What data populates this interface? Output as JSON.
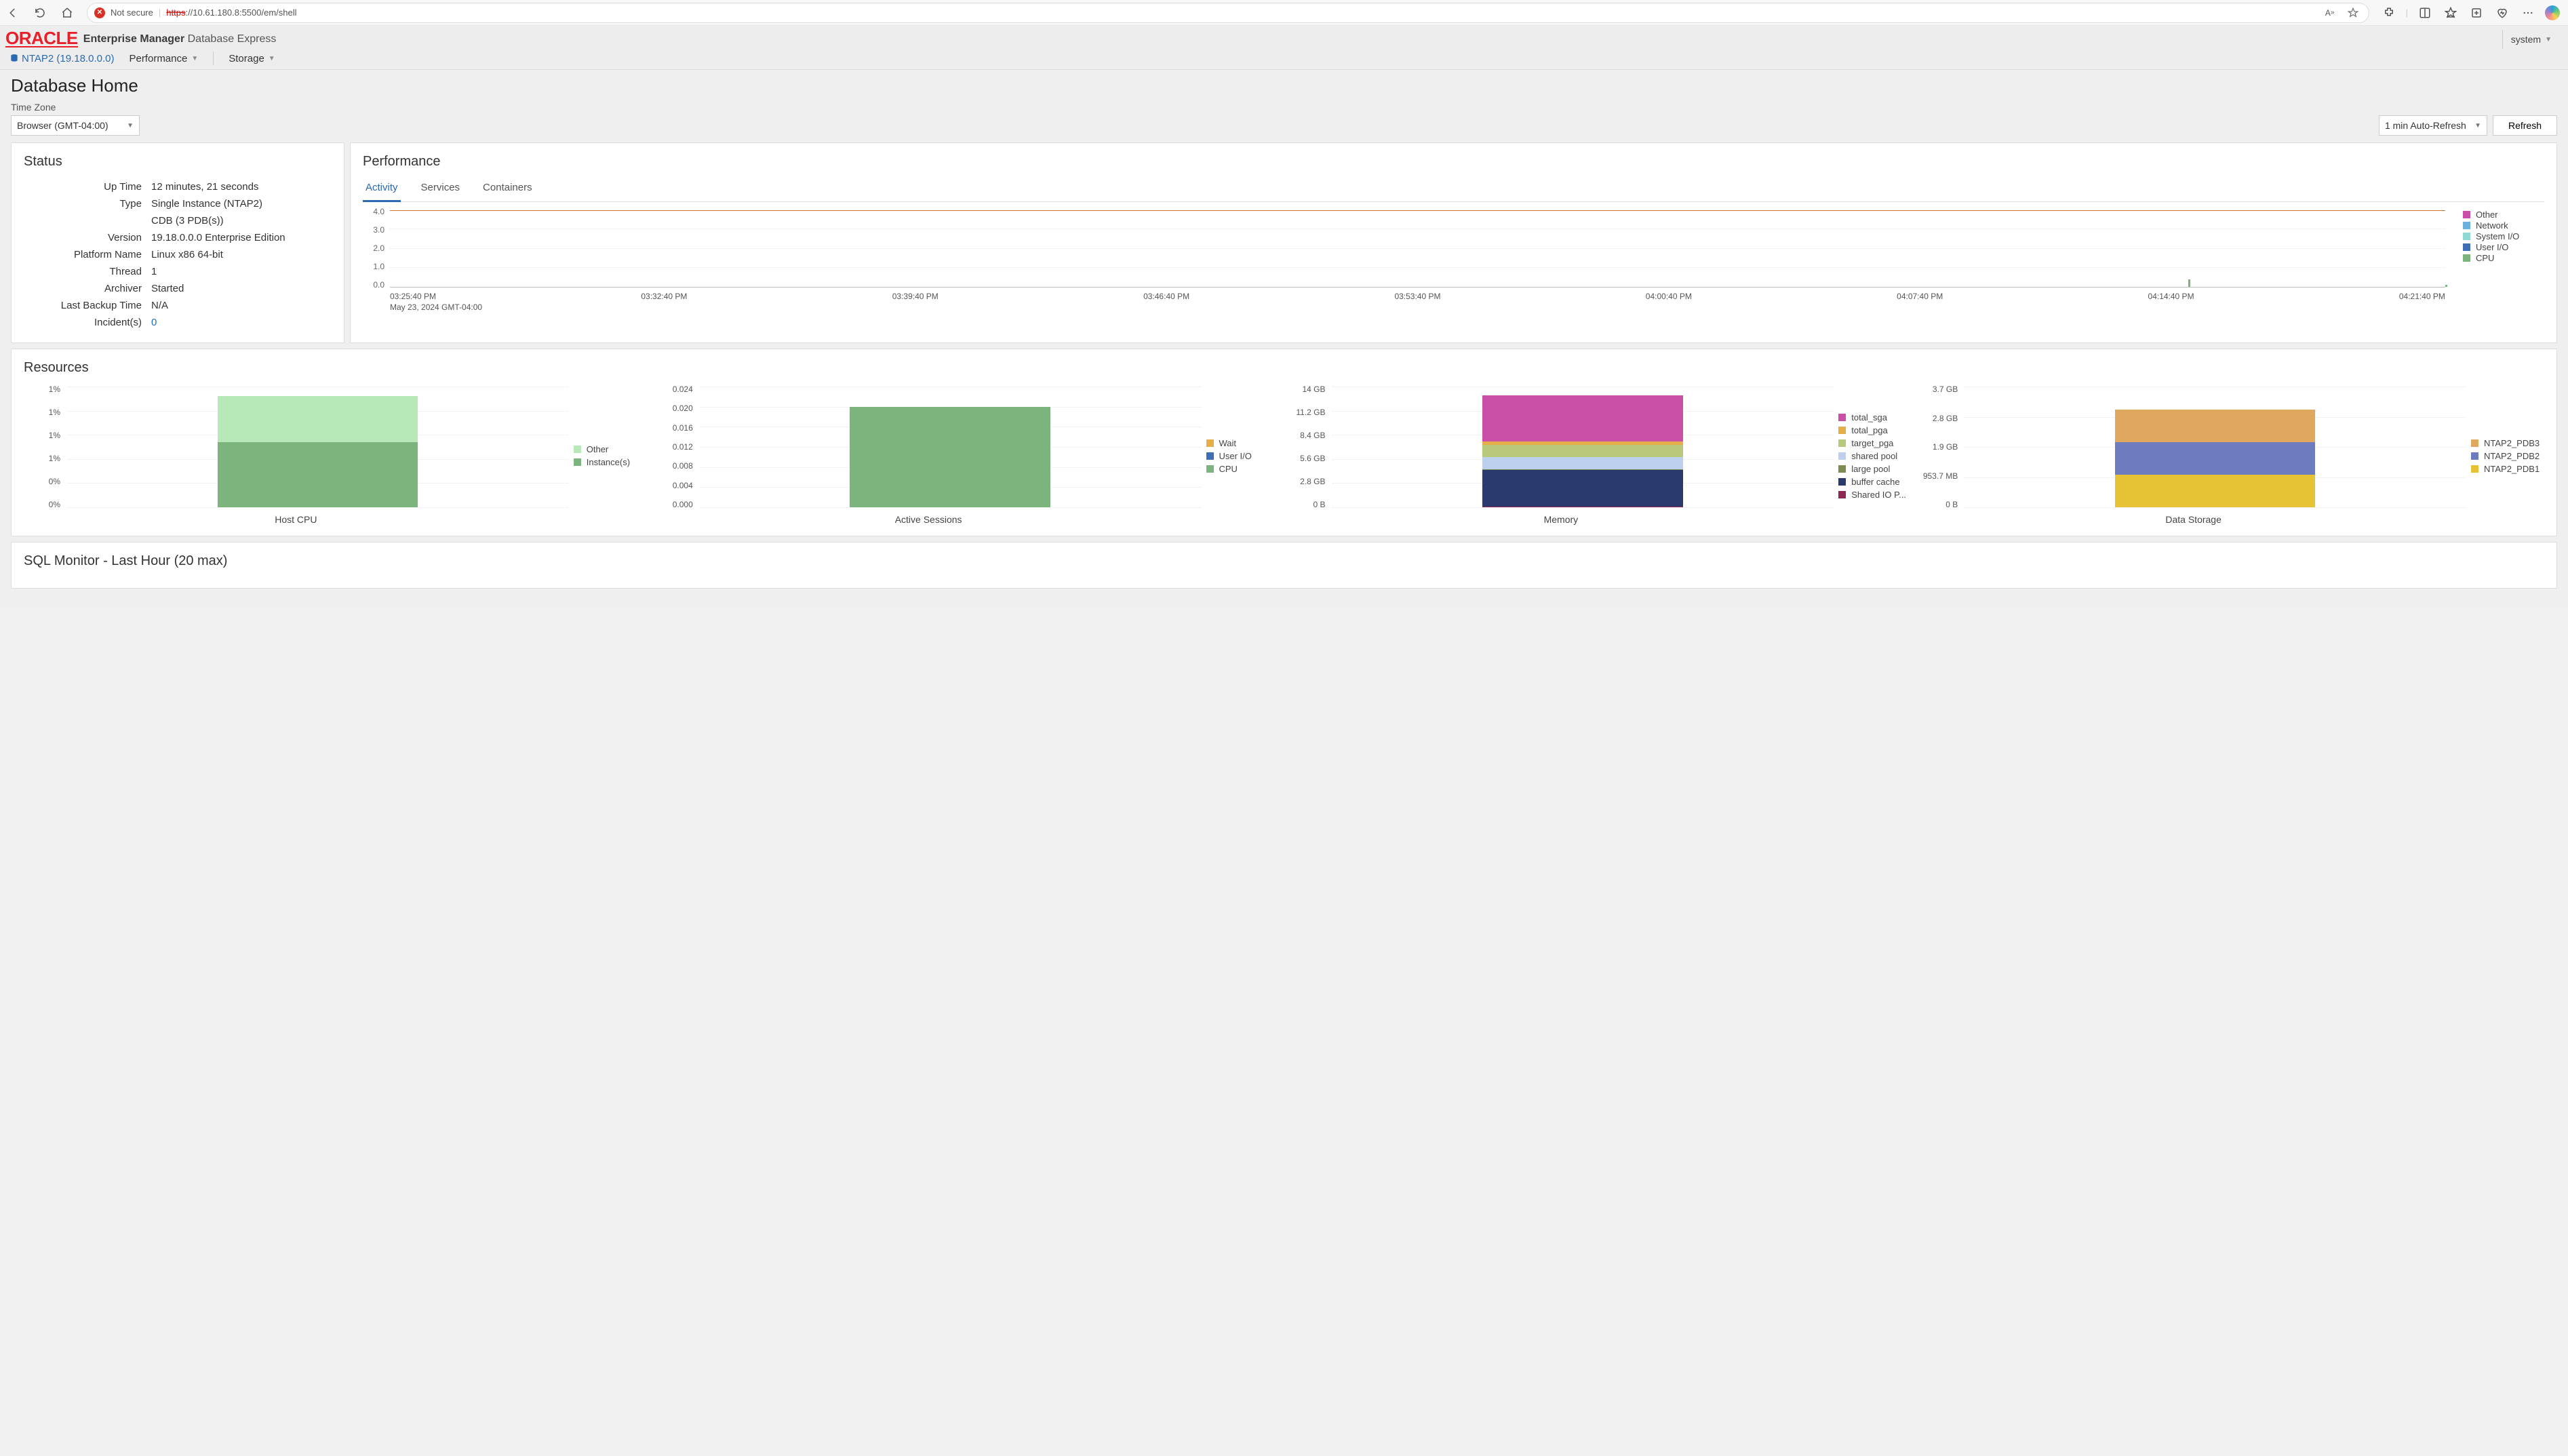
{
  "browser": {
    "not_secure_label": "Not secure",
    "url_proto": "https",
    "url_rest": "://10.61.180.8:5500/em/shell"
  },
  "header": {
    "logo_text": "ORACLE",
    "product_bold": "Enterprise Manager",
    "product_light": "Database Express",
    "user": "system"
  },
  "nav": {
    "target": "NTAP2 (19.18.0.0.0)",
    "menu1": "Performance",
    "menu2": "Storage"
  },
  "page_title": "Database Home",
  "tz_label": "Time Zone",
  "tz_value": "Browser (GMT-04:00)",
  "refresh_select": "1 min Auto-Refresh",
  "refresh_btn": "Refresh",
  "status": {
    "title": "Status",
    "rows": [
      {
        "label": "Up Time",
        "value": "12 minutes, 21 seconds"
      },
      {
        "label": "Type",
        "value": "Single Instance (NTAP2)"
      },
      {
        "label": "",
        "value": "CDB (3 PDB(s))"
      },
      {
        "label": "Version",
        "value": "19.18.0.0.0 Enterprise Edition"
      },
      {
        "label": "Platform Name",
        "value": "Linux x86 64-bit"
      },
      {
        "label": "Thread",
        "value": "1"
      },
      {
        "label": "Archiver",
        "value": "Started"
      },
      {
        "label": "Last Backup Time",
        "value": "N/A"
      },
      {
        "label": "Incident(s)",
        "value": "0",
        "link": true
      }
    ]
  },
  "performance": {
    "title": "Performance",
    "tabs": [
      "Activity",
      "Services",
      "Containers"
    ],
    "active_tab": 0,
    "y_ticks": [
      "4.0",
      "3.0",
      "2.0",
      "1.0",
      "0.0"
    ],
    "x_ticks": [
      "03:25:40 PM",
      "03:32:40 PM",
      "03:39:40 PM",
      "03:46:40 PM",
      "03:53:40 PM",
      "04:00:40 PM",
      "04:07:40 PM",
      "04:14:40 PM",
      "04:21:40 PM"
    ],
    "date_line": "May 23, 2024 GMT-04:00",
    "legend": [
      {
        "label": "Other",
        "color": "#c94fa9"
      },
      {
        "label": "Network",
        "color": "#6cb0e0"
      },
      {
        "label": "System I/O",
        "color": "#8fd8d4"
      },
      {
        "label": "User I/O",
        "color": "#3e6fb6"
      },
      {
        "label": "CPU",
        "color": "#7cb47e"
      }
    ]
  },
  "resources": {
    "title": "Resources",
    "host_cpu": {
      "title": "Host CPU",
      "y_ticks": [
        "1%",
        "1%",
        "1%",
        "1%",
        "0%",
        "0%"
      ],
      "legend": [
        {
          "label": "Other",
          "color": "#b9e8b8"
        },
        {
          "label": "Instance(s)",
          "color": "#7cb47e"
        }
      ]
    },
    "active_sessions": {
      "title": "Active Sessions",
      "y_ticks": [
        "0.024",
        "0.020",
        "0.016",
        "0.012",
        "0.008",
        "0.004",
        "0.000"
      ],
      "legend": [
        {
          "label": "Wait",
          "color": "#e6ae49"
        },
        {
          "label": "User I/O",
          "color": "#3e6fb6"
        },
        {
          "label": "CPU",
          "color": "#7cb47e"
        }
      ]
    },
    "memory": {
      "title": "Memory",
      "y_ticks": [
        "14 GB",
        "11.2 GB",
        "8.4 GB",
        "5.6 GB",
        "2.8 GB",
        "0 B"
      ],
      "legend": [
        {
          "label": "total_sga",
          "color": "#c94fa9"
        },
        {
          "label": "total_pga",
          "color": "#e6ae49"
        },
        {
          "label": "target_pga",
          "color": "#b9c97c"
        },
        {
          "label": "shared pool",
          "color": "#bcd0ee"
        },
        {
          "label": "large pool",
          "color": "#7c8e4f"
        },
        {
          "label": "buffer cache",
          "color": "#2b3a6e"
        },
        {
          "label": "Shared IO P...",
          "color": "#8b2752"
        }
      ]
    },
    "data_storage": {
      "title": "Data Storage",
      "y_ticks": [
        "3.7 GB",
        "2.8 GB",
        "1.9 GB",
        "953.7 MB",
        "0 B"
      ],
      "legend": [
        {
          "label": "NTAP2_PDB3",
          "color": "#e0a85e"
        },
        {
          "label": "NTAP2_PDB2",
          "color": "#6d7bbf"
        },
        {
          "label": "NTAP2_PDB1",
          "color": "#e6c235"
        }
      ]
    }
  },
  "sql_monitor": {
    "title": "SQL Monitor - Last Hour (20 max)"
  },
  "chart_data": {
    "activity": {
      "type": "area",
      "title": "Activity",
      "xlabel": "",
      "ylabel": "",
      "ylim": [
        0,
        4.0
      ],
      "x": [
        "03:25:40 PM",
        "03:32:40 PM",
        "03:39:40 PM",
        "03:46:40 PM",
        "03:53:40 PM",
        "04:00:40 PM",
        "04:07:40 PM",
        "04:14:40 PM",
        "04:21:40 PM"
      ],
      "baseline": 4.0,
      "series": [
        {
          "name": "Other",
          "color": "#c94fa9",
          "values": [
            0,
            0,
            0,
            0,
            0,
            0,
            0,
            0.3,
            0
          ]
        },
        {
          "name": "Network",
          "color": "#6cb0e0",
          "values": [
            0,
            0,
            0,
            0,
            0,
            0,
            0,
            0,
            0
          ]
        },
        {
          "name": "System I/O",
          "color": "#8fd8d4",
          "values": [
            0,
            0,
            0,
            0,
            0,
            0,
            0,
            0,
            0
          ]
        },
        {
          "name": "User I/O",
          "color": "#3e6fb6",
          "values": [
            0,
            0,
            0,
            0,
            0,
            0,
            0,
            0,
            0
          ]
        },
        {
          "name": "CPU",
          "color": "#7cb47e",
          "values": [
            0,
            0,
            0,
            0,
            0,
            0,
            0,
            0.4,
            0.1
          ]
        }
      ],
      "date": "May 23, 2024 GMT-04:00"
    },
    "host_cpu": {
      "type": "bar",
      "title": "Host CPU",
      "categories": [
        ""
      ],
      "ylim": [
        0,
        1.3
      ],
      "unit": "%",
      "series": [
        {
          "name": "Other",
          "color": "#b9e8b8",
          "values": [
            0.5
          ]
        },
        {
          "name": "Instance(s)",
          "color": "#7cb47e",
          "values": [
            0.7
          ]
        }
      ]
    },
    "active_sessions": {
      "type": "bar",
      "title": "Active Sessions",
      "categories": [
        ""
      ],
      "ylim": [
        0,
        0.024
      ],
      "series": [
        {
          "name": "Wait",
          "color": "#e6ae49",
          "values": [
            0
          ]
        },
        {
          "name": "User I/O",
          "color": "#3e6fb6",
          "values": [
            0
          ]
        },
        {
          "name": "CPU",
          "color": "#7cb47e",
          "values": [
            0.02
          ]
        }
      ]
    },
    "memory": {
      "type": "bar",
      "title": "Memory",
      "categories": [
        ""
      ],
      "ylim": [
        0,
        14
      ],
      "unit": "GB",
      "series": [
        {
          "name": "total_sga",
          "color": "#c94fa9",
          "values": [
            5.4
          ]
        },
        {
          "name": "total_pga",
          "color": "#e6ae49",
          "values": [
            0.4
          ]
        },
        {
          "name": "target_pga",
          "color": "#b9c97c",
          "values": [
            1.4
          ]
        },
        {
          "name": "shared pool",
          "color": "#bcd0ee",
          "values": [
            1.4
          ]
        },
        {
          "name": "large pool",
          "color": "#7c8e4f",
          "values": [
            0.1
          ]
        },
        {
          "name": "buffer cache",
          "color": "#2b3a6e",
          "values": [
            4.2
          ]
        },
        {
          "name": "Shared IO P...",
          "color": "#8b2752",
          "values": [
            0.1
          ]
        }
      ]
    },
    "data_storage": {
      "type": "bar",
      "title": "Data Storage",
      "categories": [
        ""
      ],
      "ylim": [
        0,
        3.7
      ],
      "unit": "GB",
      "series": [
        {
          "name": "NTAP2_PDB3",
          "color": "#e0a85e",
          "values": [
            1.0
          ]
        },
        {
          "name": "NTAP2_PDB2",
          "color": "#6d7bbf",
          "values": [
            1.0
          ]
        },
        {
          "name": "NTAP2_PDB1",
          "color": "#e6c235",
          "values": [
            1.0
          ]
        }
      ]
    }
  }
}
